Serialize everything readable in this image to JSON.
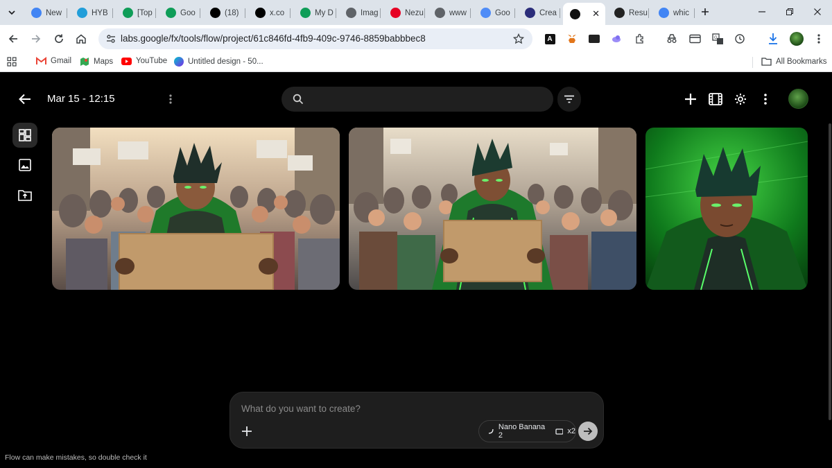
{
  "browser": {
    "tabs": [
      {
        "label": "New",
        "icon": "chrome-icon",
        "color": "#4285f4"
      },
      {
        "label": "HYB",
        "icon": "telegram-icon",
        "color": "#229ed9"
      },
      {
        "label": "[Top",
        "icon": "google-drive-icon",
        "color": "#0f9d58"
      },
      {
        "label": "Goo",
        "icon": "google-drive-icon",
        "color": "#0f9d58"
      },
      {
        "label": "(18)",
        "icon": "x-icon",
        "color": "#000000"
      },
      {
        "label": "x.co",
        "icon": "x-circle-icon",
        "color": "#000000"
      },
      {
        "label": "My D",
        "icon": "google-drive-icon",
        "color": "#0f9d58"
      },
      {
        "label": "Imag",
        "icon": "openai-icon",
        "color": "#5f6368"
      },
      {
        "label": "Nezu",
        "icon": "pinterest-icon",
        "color": "#e60023"
      },
      {
        "label": "www",
        "icon": "spiral-icon",
        "color": "#5f6368"
      },
      {
        "label": "Goo",
        "icon": "gemini-icon",
        "color": "#4f8cf7"
      },
      {
        "label": "Crea",
        "icon": "perplexity-icon",
        "color": "#2b2d7a"
      },
      {
        "label": "",
        "icon": "flow-icon",
        "color": "#111111"
      },
      {
        "label": "Resu",
        "icon": "openai-dark-icon",
        "color": "#222222"
      },
      {
        "label": "whic",
        "icon": "google-icon",
        "color": "#4285f4"
      }
    ],
    "url": "labs.google/fx/tools/flow/project/61c846fd-4fb9-409c-9746-8859babbbec8",
    "bookmarks": [
      {
        "label": "Gmail",
        "icon": "gmail-icon"
      },
      {
        "label": "Maps",
        "icon": "maps-icon"
      },
      {
        "label": "YouTube",
        "icon": "youtube-icon"
      },
      {
        "label": "Untitled design - 50...",
        "icon": "canva-icon"
      }
    ],
    "all_bookmarks": "All Bookmarks"
  },
  "app": {
    "title": "Mar 15 - 12:15",
    "search_placeholder": "",
    "composer": {
      "placeholder": "What do you want to create?",
      "model": "Nano Banana 2",
      "count": "x2"
    },
    "disclaimer": "Flow can make mistakes, so double check it",
    "colors": {
      "background": "#000000",
      "surface": "#1e1e1e",
      "accent_green": "#22a24a"
    }
  }
}
